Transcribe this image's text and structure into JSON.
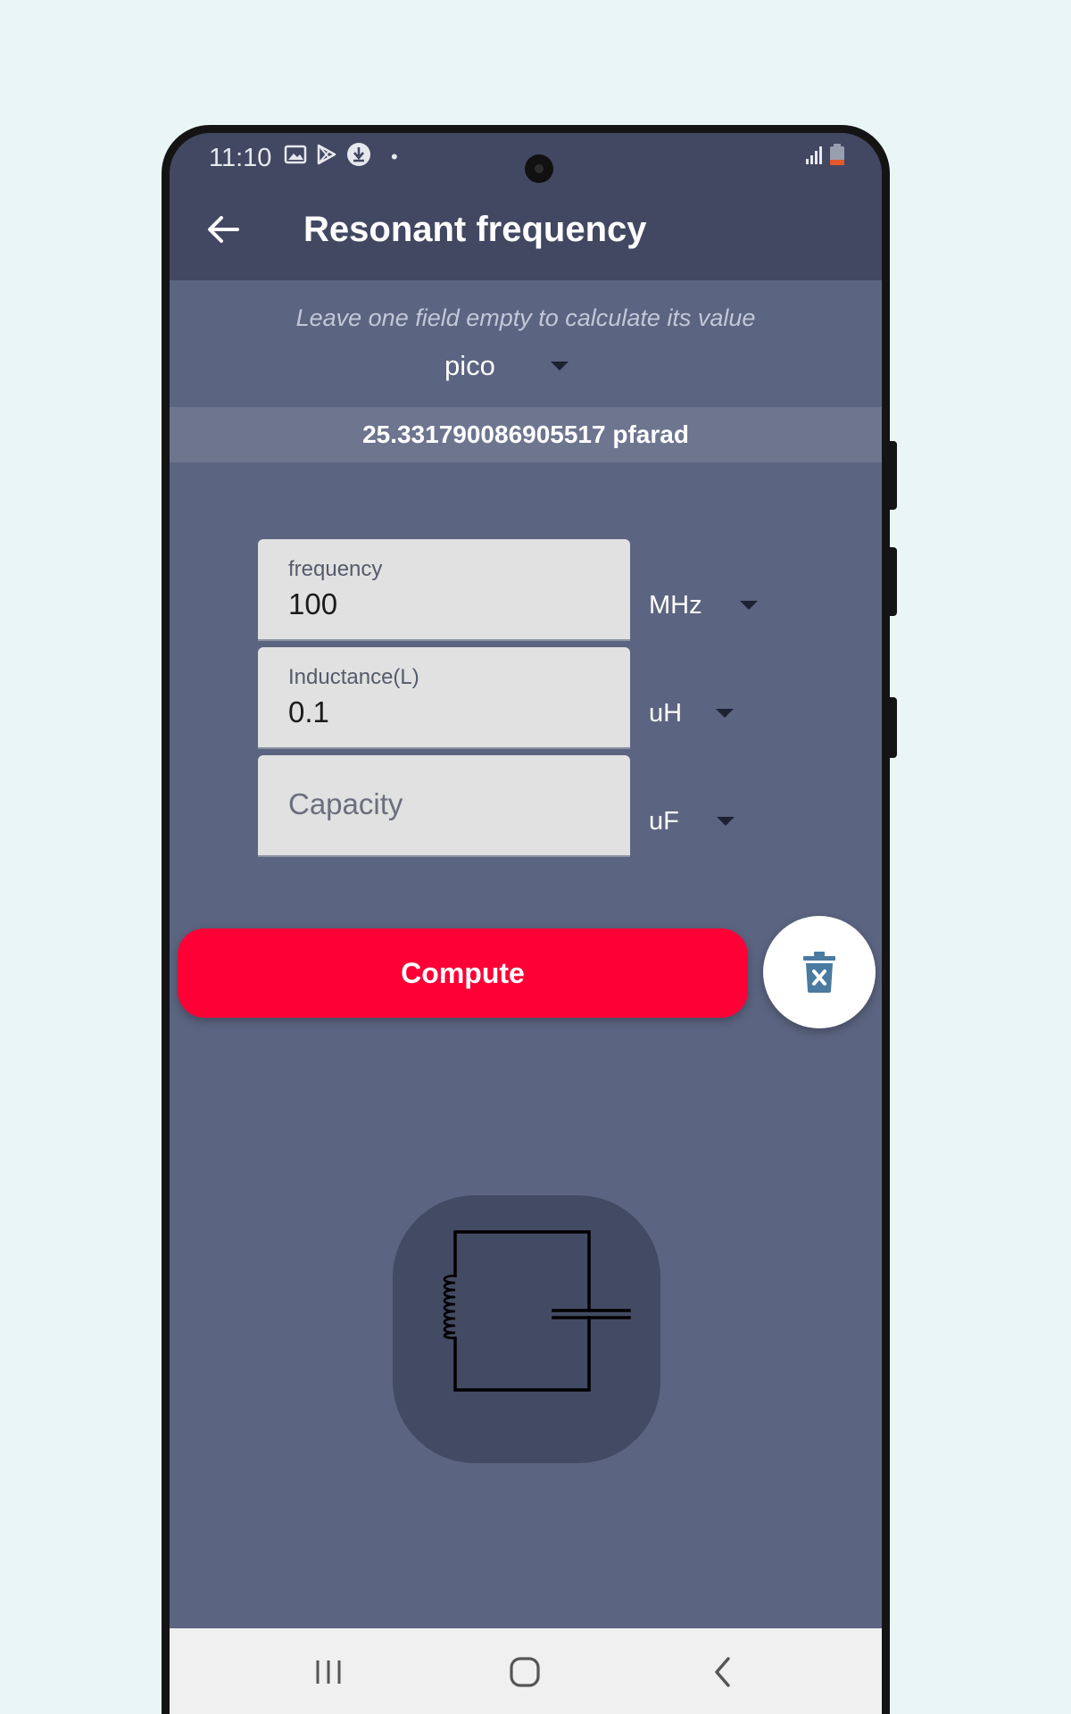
{
  "status_bar": {
    "time": "11:10",
    "icons": [
      "image-icon",
      "play-store-icon",
      "download-icon"
    ],
    "dot": "•",
    "right_icons": [
      "signal-icon",
      "battery-low-icon"
    ]
  },
  "app_bar": {
    "title": "Resonant frequency",
    "back_icon": "arrow-left-icon"
  },
  "hint": "Leave one field empty to calculate its value",
  "result_unit": "pico",
  "result": "25.331790086905517 pfarad",
  "fields": [
    {
      "label": "frequency",
      "value": "100",
      "unit": "MHz"
    },
    {
      "label": "Inductance(L)",
      "value": "0.1",
      "unit": "uH"
    },
    {
      "placeholder": "Capacity",
      "value": "",
      "unit": "uF"
    }
  ],
  "compute_label": "Compute",
  "clear_icon": "trash-x-icon",
  "colors": {
    "app_bar": "#424862",
    "background": "#5b6480",
    "result_bar": "#6d758f",
    "compute": "#ff0036",
    "trash": "#4a7aa0"
  },
  "nav_bar": [
    "recents-icon",
    "home-icon",
    "back-icon"
  ]
}
